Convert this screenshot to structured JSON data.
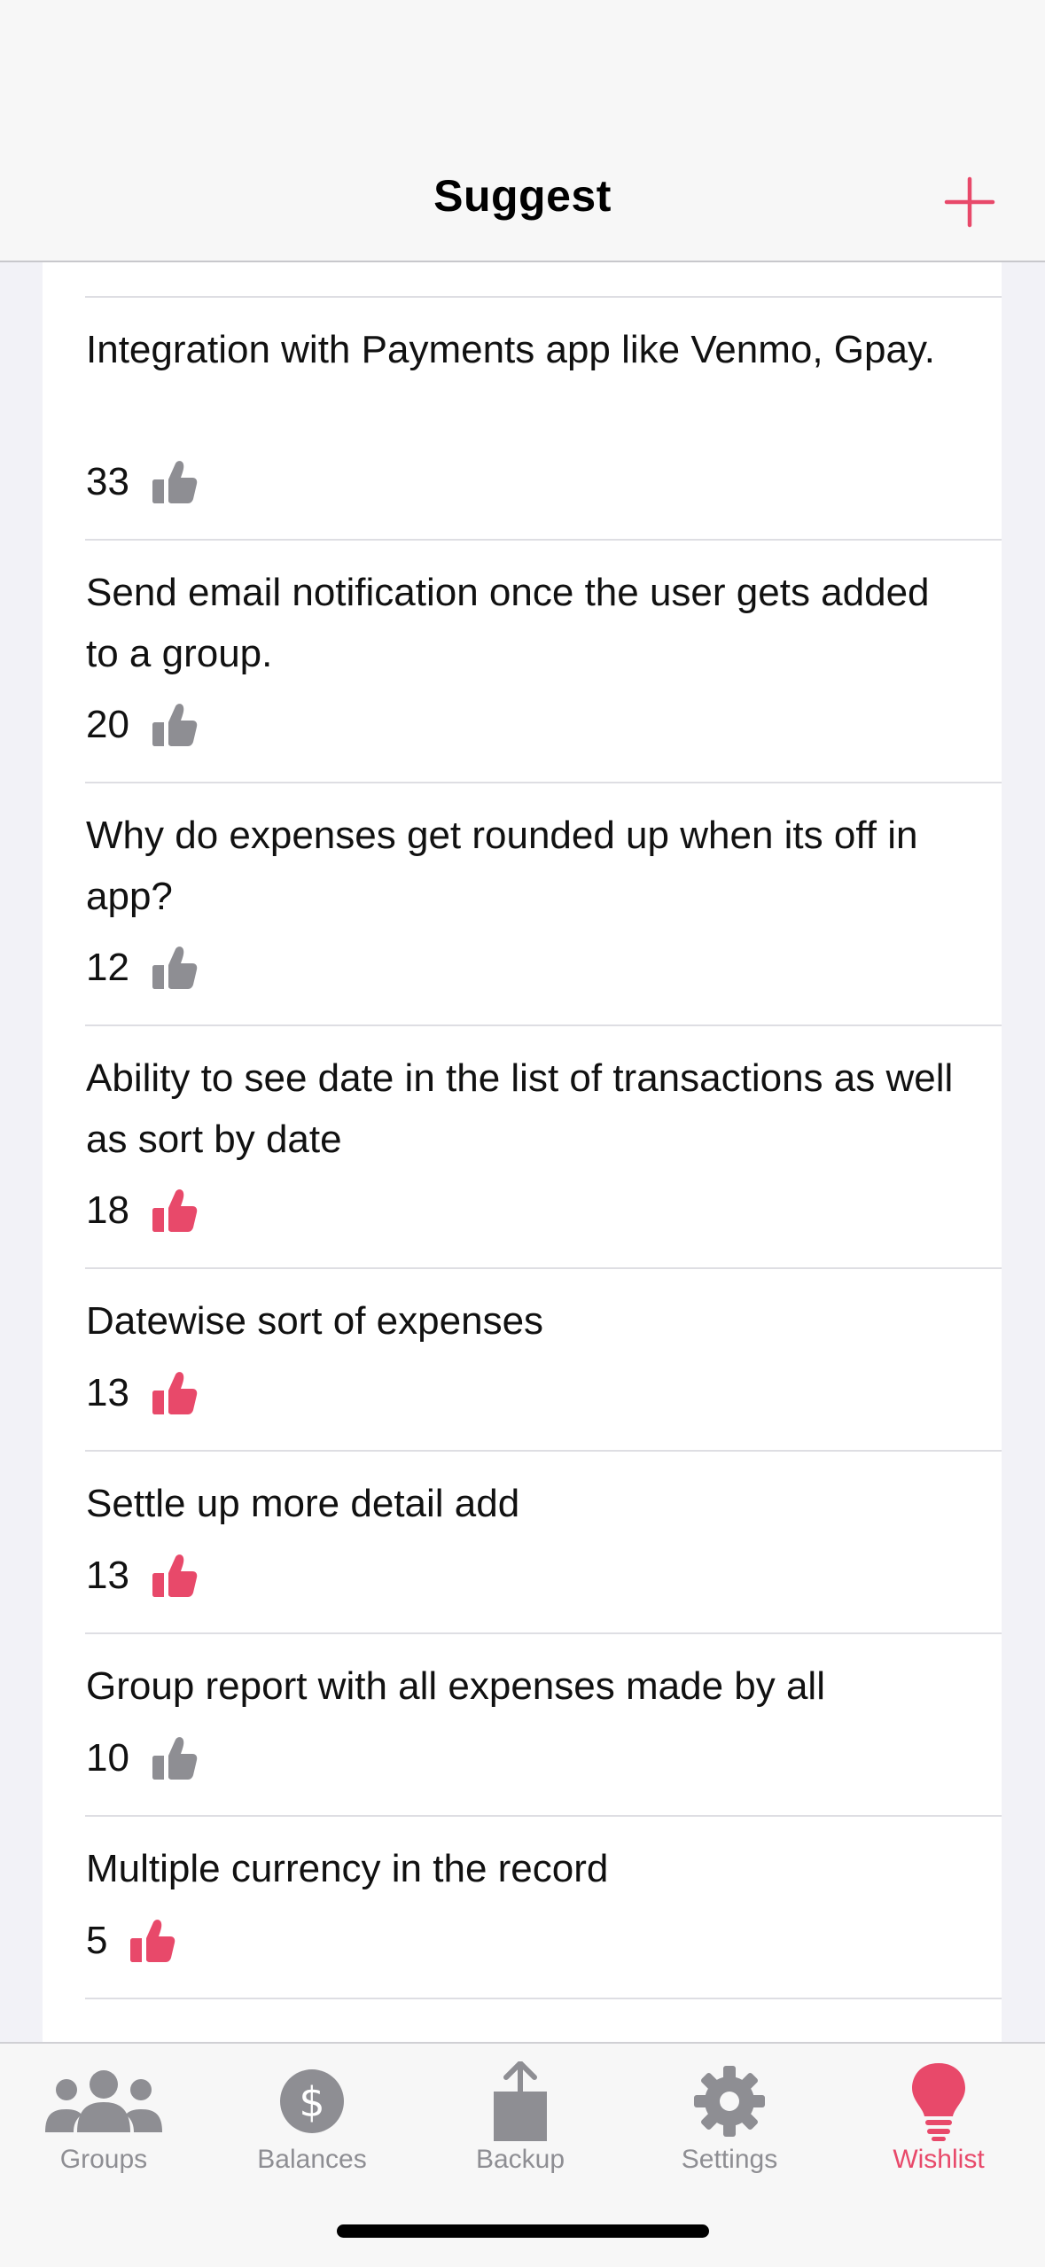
{
  "nav": {
    "title": "Suggest",
    "add_icon": "plus-icon"
  },
  "colors": {
    "accent": "#e8496a",
    "inactive": "#8e8e93"
  },
  "suggestions": [
    {
      "title": "Integration with Payments app like Venmo, Gpay.",
      "votes": "33",
      "liked": false
    },
    {
      "title": "Send email notification once the user gets added to a group.",
      "votes": "20",
      "liked": false
    },
    {
      "title": "Why do expenses get rounded up when its off in app?",
      "votes": "12",
      "liked": false
    },
    {
      "title": "Ability to see date in the list of transactions as well as sort by date",
      "votes": "18",
      "liked": true
    },
    {
      "title": "Datewise sort of expenses",
      "votes": "13",
      "liked": true
    },
    {
      "title": "Settle up more detail add",
      "votes": "13",
      "liked": true
    },
    {
      "title": "Group report with all expenses made by all",
      "votes": "10",
      "liked": false
    },
    {
      "title": "Multiple currency in the record",
      "votes": "5",
      "liked": true
    }
  ],
  "tabs": [
    {
      "label": "Groups",
      "icon": "groups-icon",
      "active": false
    },
    {
      "label": "Balances",
      "icon": "dollar-icon",
      "active": false
    },
    {
      "label": "Backup",
      "icon": "share-icon",
      "active": false
    },
    {
      "label": "Settings",
      "icon": "gear-icon",
      "active": false
    },
    {
      "label": "Wishlist",
      "icon": "lightbulb-icon",
      "active": true
    }
  ]
}
